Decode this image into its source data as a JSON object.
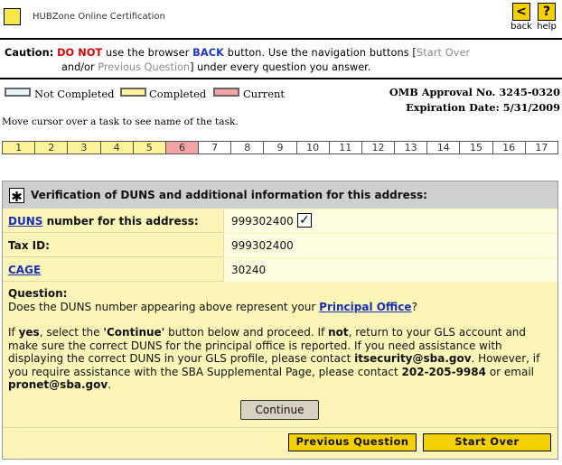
{
  "header": {
    "title": "HUBZone Online Certification",
    "back_label": "back",
    "help_label": "help",
    "back_glyph": "<",
    "help_glyph": "?"
  },
  "caution": {
    "prefix": "Caution:",
    "do_not": "DO NOT",
    "mid1": "use the browser",
    "back_word": "BACK",
    "mid2": "button. Use the navigation buttons [",
    "start_over": "Start Over",
    "line2_a": "and/or",
    "prev_question": "Previous Question",
    "line2_b": "] under every question you answer."
  },
  "legend": {
    "not_completed": "Not Completed",
    "completed": "Completed",
    "current": "Current",
    "colors": {
      "not_completed": "#e8f4fb",
      "completed": "#fdf49a",
      "current": "#f3a3a3"
    }
  },
  "omb": {
    "approval": "OMB Approval No. 3245-0320",
    "expiration": "Expiration Date: 5/31/2009"
  },
  "hint": "Move cursor over a task to see name of the task.",
  "tasks": [
    {
      "label": "1",
      "state": "completed"
    },
    {
      "label": "2",
      "state": "completed"
    },
    {
      "label": "3",
      "state": "completed"
    },
    {
      "label": "4",
      "state": "completed"
    },
    {
      "label": "5",
      "state": "completed"
    },
    {
      "label": "6",
      "state": "current"
    },
    {
      "label": "7",
      "state": "not_completed"
    },
    {
      "label": "8",
      "state": "not_completed"
    },
    {
      "label": "9",
      "state": "not_completed"
    },
    {
      "label": "10",
      "state": "not_completed"
    },
    {
      "label": "11",
      "state": "not_completed"
    },
    {
      "label": "12",
      "state": "not_completed"
    },
    {
      "label": "13",
      "state": "not_completed"
    },
    {
      "label": "14",
      "state": "not_completed"
    },
    {
      "label": "15",
      "state": "not_completed"
    },
    {
      "label": "16",
      "state": "not_completed"
    },
    {
      "label": "17",
      "state": "not_completed"
    }
  ],
  "panel": {
    "title": "Verification of DUNS and additional information for this address:",
    "duns_link": "DUNS",
    "duns_label_rest": " number for this address:",
    "duns_value": "999302400",
    "duns_checked": true,
    "tax_label": "Tax ID:",
    "tax_value": "999302400",
    "cage_link": "CAGE",
    "cage_value": "30240",
    "question_heading": "Question:",
    "question_text": "Does the DUNS number appearing above represent your",
    "principal_office": "Principal Office",
    "question_end": "?",
    "instr_1": "If",
    "yes": "yes",
    "instr_2": ", select the",
    "continue_quoted": "'Continue'",
    "instr_3": "button below and proceed. If",
    "not": "not",
    "instr_4": ", return to your GLS account and make sure the correct DUNS for the principal office is reported. If you need assistance with displaying the correct DUNS in your GLS profile, please contact",
    "email_its": "itsecurity@sba.gov",
    "instr_5": ". However, if you require assistance with the SBA Supplemental Page, please contact",
    "phone": "202-205-9984",
    "instr_6": "or email",
    "email_pronet": "pronet@sba.gov",
    "instr_7": ".",
    "continue_label": "Continue",
    "prev_label": "Previous Question",
    "start_label": "Start Over"
  }
}
